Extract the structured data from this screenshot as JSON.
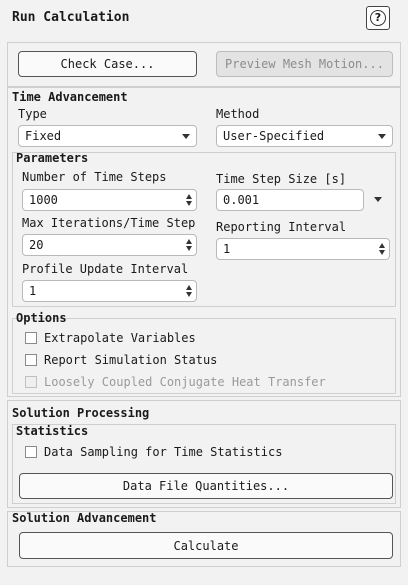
{
  "title": "Run Calculation",
  "help_icon": "question-mark-icon",
  "buttons": {
    "check_case": "Check Case...",
    "preview_mesh_motion": "Preview Mesh Motion..."
  },
  "time_advancement": {
    "heading": "Time Advancement",
    "type_label": "Type",
    "type_value": "Fixed",
    "method_label": "Method",
    "method_value": "User-Specified"
  },
  "parameters": {
    "heading": "Parameters",
    "num_steps_label": "Number of Time Steps",
    "num_steps_value": "1000",
    "step_size_label": "Time Step Size [s]",
    "step_size_value": "0.001",
    "max_iter_label": "Max Iterations/Time Step",
    "max_iter_value": "20",
    "reporting_label": "Reporting Interval",
    "reporting_value": "1",
    "profile_label": "Profile Update Interval",
    "profile_value": "1"
  },
  "options": {
    "heading": "Options",
    "items": [
      "Extrapolate Variables",
      "Report Simulation Status",
      "Loosely Coupled Conjugate Heat Transfer"
    ]
  },
  "solution_processing": {
    "heading": "Solution Processing",
    "statistics_heading": "Statistics",
    "data_sampling_label": "Data Sampling for Time Statistics",
    "data_file_button": "Data File Quantities..."
  },
  "solution_advancement": {
    "heading": "Solution Advancement",
    "calculate_button": "Calculate"
  }
}
